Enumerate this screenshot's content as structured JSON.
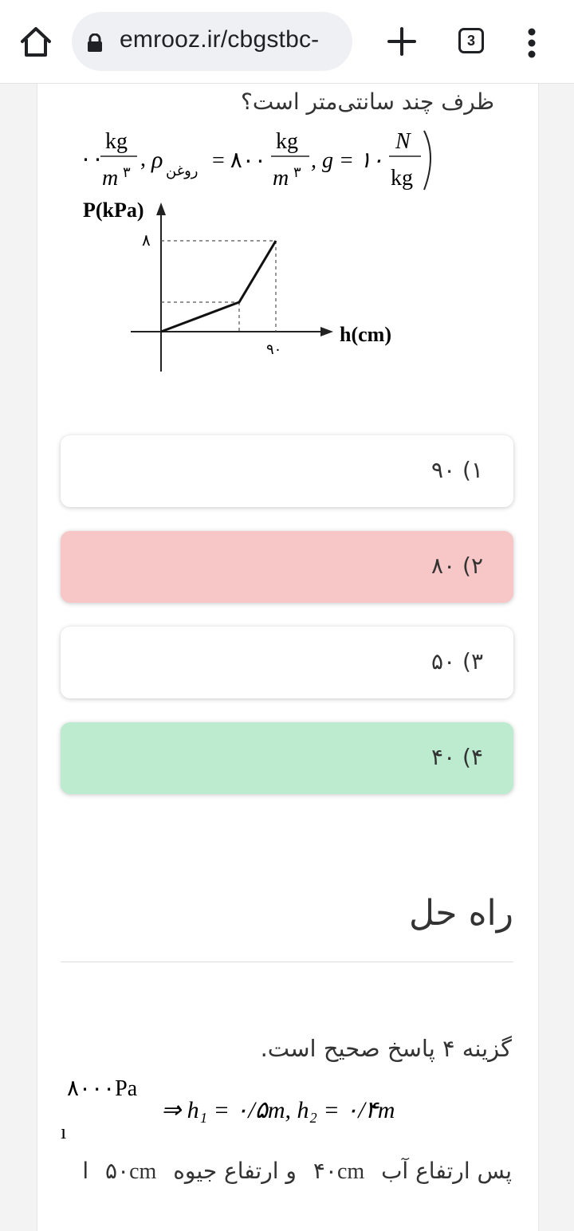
{
  "browser": {
    "url": "emrooz.ir/cbgstbc-",
    "tab_count": "3"
  },
  "question": {
    "line": "ظرف چند سانتی‌متر است؟",
    "formula": {
      "rho_water_tail": "۰۰",
      "unit_num": "kg",
      "unit_den": "m",
      "exp": "۳",
      "rho_symbol": "ρ",
      "oil_sub": "روغن",
      "oil_value": "= ۸۰۰",
      "g_label": ", g = ۱۰",
      "g_num": "N",
      "g_den": "kg"
    },
    "graph": {
      "ylabel": "P(kPa)",
      "xlabel": "h(cm)",
      "y_tick": "۸",
      "x_tick": "۹۰"
    }
  },
  "options": [
    {
      "label": "۱) ۹۰",
      "state": "default",
      "color": "#ffffff"
    },
    {
      "label": "۲) ۸۰",
      "state": "wrong",
      "color": "#f7c7c7"
    },
    {
      "label": "۳) ۵۰",
      "state": "default",
      "color": "#ffffff"
    },
    {
      "label": "۴) ۴۰",
      "state": "correct",
      "color": "#bdebd0"
    }
  ],
  "solution": {
    "title": "راه حل",
    "answer": "گزینه ۴ پاسخ صحیح است.",
    "math_top": "۸۰۰۰Pa",
    "math_line": "⇒ h₁ = ۰/۵m, h₂ = ۰/۴m",
    "math_fragment": "ı",
    "final_text": "پس ارتفاع آب",
    "final_water": "۴۰cm",
    "final_and": "و ارتفاع جیوه",
    "final_mercury": "۵۰cm",
    "final_tail": "ا"
  }
}
